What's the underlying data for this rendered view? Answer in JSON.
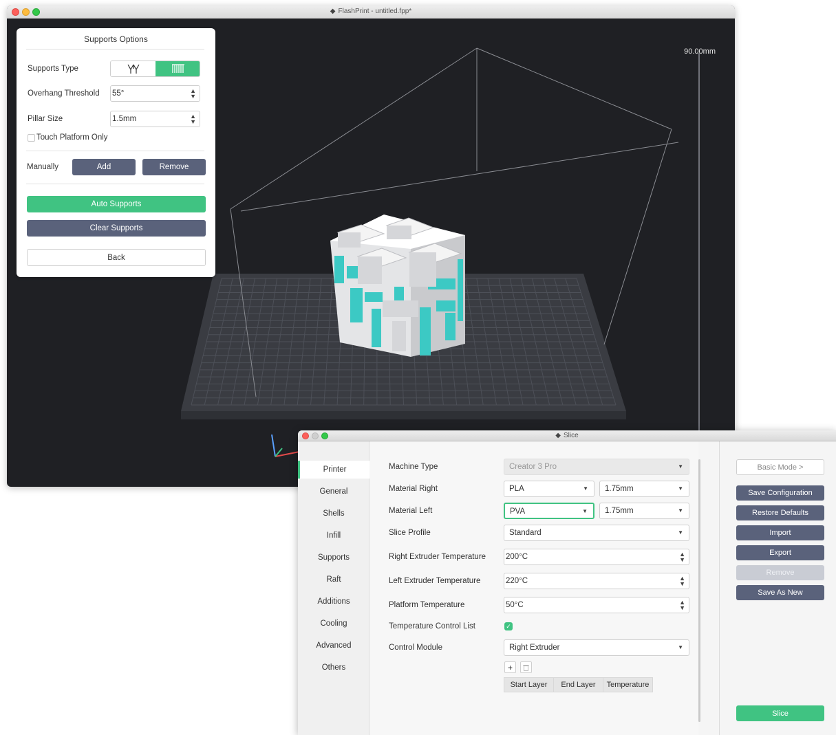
{
  "main_window": {
    "title": "FlashPrint - untitled.fpp*",
    "height_label": "90.00mm"
  },
  "supports_panel": {
    "title": "Supports Options",
    "supports_type_label": "Supports Type",
    "supports_type_options": [
      "tree-supports-icon",
      "linear-supports-icon"
    ],
    "supports_type_selected": "linear-supports-icon",
    "overhang_label": "Overhang Threshold",
    "overhang_value": "55°",
    "pillar_label": "Pillar Size",
    "pillar_value": "1.5mm",
    "touch_platform_label": "Touch Platform Only",
    "touch_platform_checked": false,
    "manually_label": "Manually",
    "add_label": "Add",
    "remove_label": "Remove",
    "auto_supports_label": "Auto Supports",
    "clear_supports_label": "Clear Supports",
    "back_label": "Back"
  },
  "slice_window": {
    "title": "Slice",
    "sidebar": [
      "Printer",
      "General",
      "Shells",
      "Infill",
      "Supports",
      "Raft",
      "Additions",
      "Cooling",
      "Advanced",
      "Others"
    ],
    "sidebar_active": "Printer",
    "fields": {
      "machine_type_label": "Machine Type",
      "machine_type_value": "Creator 3 Pro",
      "material_right_label": "Material Right",
      "material_right_value": "PLA",
      "material_right_diameter": "1.75mm",
      "material_left_label": "Material Left",
      "material_left_value": "PVA",
      "material_left_diameter": "1.75mm",
      "slice_profile_label": "Slice Profile",
      "slice_profile_value": "Standard",
      "right_temp_label": "Right Extruder Temperature",
      "right_temp_value": "200°C",
      "left_temp_label": "Left Extruder Temperature",
      "left_temp_value": "220°C",
      "platform_temp_label": "Platform Temperature",
      "platform_temp_value": "50°C",
      "temp_control_label": "Temperature Control List",
      "temp_control_checked": true,
      "control_module_label": "Control Module",
      "control_module_value": "Right Extruder"
    },
    "table_headers": [
      "Start Layer",
      "End Layer",
      "Temperature"
    ],
    "buttons": {
      "basic_mode": "Basic Mode >",
      "save_configuration": "Save Configuration",
      "restore_defaults": "Restore Defaults",
      "import": "Import",
      "export": "Export",
      "remove": "Remove",
      "save_as_new": "Save As New",
      "slice": "Slice"
    }
  },
  "colors": {
    "accent_green": "#40c382",
    "slate_button": "#5a627b",
    "viewport_bg": "#1f2024",
    "model_teal": "#3cc9c4"
  }
}
